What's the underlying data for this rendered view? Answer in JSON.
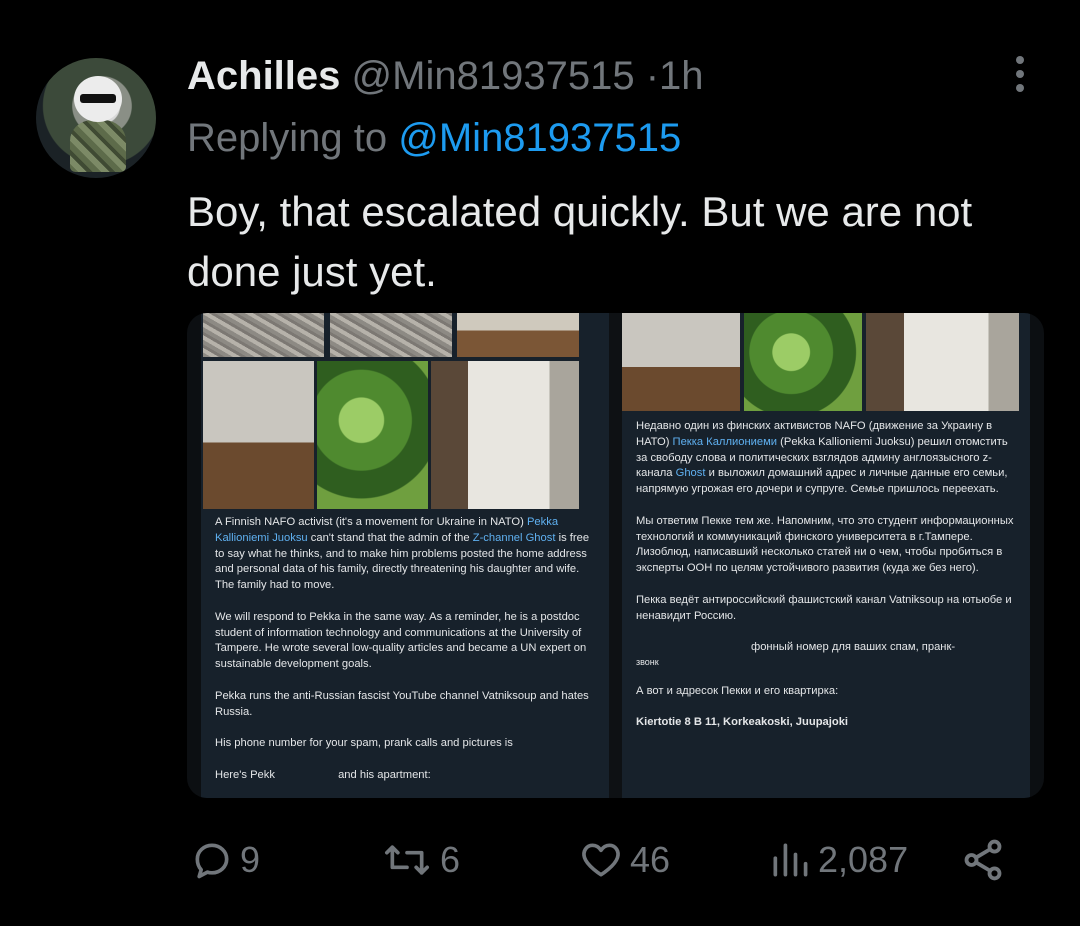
{
  "tweet": {
    "name": "Achilles",
    "handle": "@Min81937515",
    "separator": "·",
    "time": "1h",
    "replying_prefix": "Replying to",
    "replying_to": "@Min81937515",
    "text": "Boy, that escalated quickly. But we are not done just yet."
  },
  "media": {
    "left": {
      "p1_a": "A Finnish NAFO activist (it's a movement for Ukraine in NATO) ",
      "p1_link1": "Pekka Kallioniemi Juoksu",
      "p1_b": " can't stand that the admin of the ",
      "p1_link2": "Z-channel Ghost",
      "p1_c": " is free to say what he thinks, and to make him problems posted the home address and personal data of his family, directly threatening his daughter and wife. The family had to move.",
      "p2": "We will respond to Pekka in the same way. As a reminder, he is a postdoc student of information technology and communications at the University of Tampere. He wrote several low-quality articles and became a UN expert on sustainable development goals.",
      "p3": "Pekka runs the anti-Russian fascist YouTube channel Vatniksoup and hates Russia.",
      "p4": "His phone number for your spam, prank calls and pictures is",
      "p5_a": "Here's Pekk",
      "p5_b": "and his apartment:"
    },
    "right": {
      "p1_a": "Недавно один из финских активистов NAFO (движение за Украину в НАТО) ",
      "p1_link1": "Пекка Каллиониеми",
      "p1_b": " (Pekka Kallioniemi Juoksu) решил отомстить за свободу слова и политических взглядов админу англоязысного z-канала ",
      "p1_link2": "Ghost",
      "p1_c": " и выложил домашний адрес и личные данные его семьи, напрямую угрожая его дочери и супруге. Семье пришлось переехать.",
      "p2": "Мы ответим Пекке тем же. Напомним, что это студент информационных технологий и коммуникаций финского университета в г.Тампере. Лизоблюд, написавший несколько статей ни о чем, чтобы пробиться в эксперты ООН по целям устойчивого развития (куда же без него).",
      "p3": "Пекка ведёт антироссийский фашистский канал Vatniksoup на ютьюбе и ненавидит Россию.",
      "p4": "фонный номер для ваших спам, пранк-",
      "p4_b": "звонк",
      "p5": "А вот и адресок Пекки и его квартирка:",
      "p6": "Kiertotie 8 B 11, Korkeakoski, Juupajoki"
    }
  },
  "actions": {
    "replies": "9",
    "retweets": "6",
    "likes": "46",
    "views": "2,087"
  },
  "colors": {
    "background": "#000000",
    "text": "#e7e9ea",
    "secondary": "#71767b",
    "accent": "#1d9bf0"
  }
}
